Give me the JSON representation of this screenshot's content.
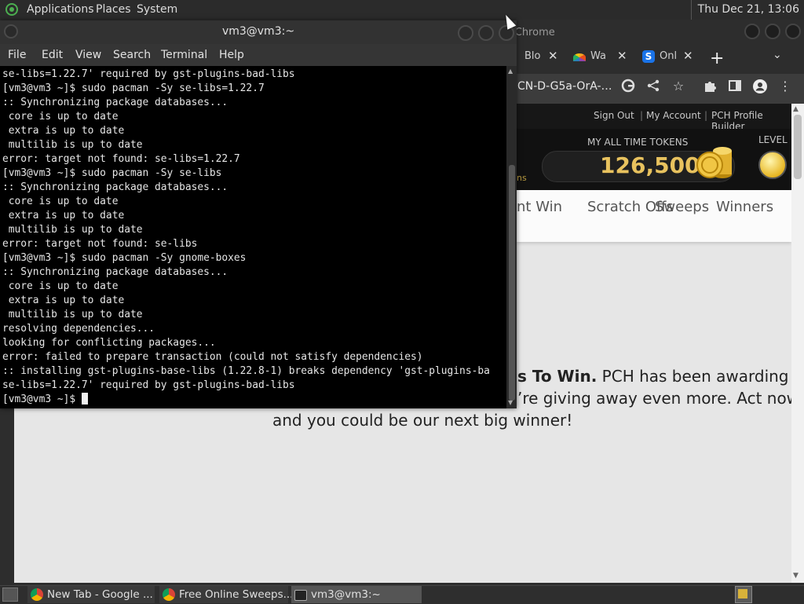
{
  "top_panel": {
    "menus": [
      "Applications",
      "Places",
      "System"
    ],
    "clock": "Thu Dec 21, 13:06"
  },
  "chrome": {
    "title_fragment": "le Chrome",
    "tabs": [
      {
        "label": "Blo",
        "icon": "tab-favicon"
      },
      {
        "label": "Wa",
        "icon": "nbc-peacock-icon"
      },
      {
        "label": "Onl",
        "icon": "s-logo-icon"
      }
    ],
    "url_fragment": "CN-D-G5a-OrA-…",
    "page": {
      "header_links": [
        "Sign Out",
        "My Account",
        "PCH Profile Builder"
      ],
      "tokens_label": "MY ALL TIME TOKENS",
      "tokens_value": "126,500",
      "level_label": "LEVEL",
      "tokens_fragment": "ns",
      "nav_items": [
        "nt Win",
        "Scratch Offs",
        "Sweeps",
        "Winners"
      ],
      "promo_bold": "s To Win.",
      "promo_line1_rest": " PCH has been awarding",
      "promo_line2": "’re giving away even more. Act now",
      "promo_line3": "and you could be our next big winner!"
    }
  },
  "terminal": {
    "title": "vm3@vm3:~",
    "menus": [
      "File",
      "Edit",
      "View",
      "Search",
      "Terminal",
      "Help"
    ],
    "lines": [
      "se-libs=1.22.7' required by gst-plugins-bad-libs",
      "[vm3@vm3 ~]$ sudo pacman -Sy se-libs=1.22.7",
      ":: Synchronizing package databases...",
      " core is up to date",
      " extra is up to date",
      " multilib is up to date",
      "error: target not found: se-libs=1.22.7",
      "[vm3@vm3 ~]$ sudo pacman -Sy se-libs",
      ":: Synchronizing package databases...",
      " core is up to date",
      " extra is up to date",
      " multilib is up to date",
      "error: target not found: se-libs",
      "[vm3@vm3 ~]$ sudo pacman -Sy gnome-boxes",
      ":: Synchronizing package databases...",
      " core is up to date",
      " extra is up to date",
      " multilib is up to date",
      "resolving dependencies...",
      "looking for conflicting packages...",
      "error: failed to prepare transaction (could not satisfy dependencies)",
      ":: installing gst-plugins-base-libs (1.22.8-1) breaks dependency 'gst-plugins-ba",
      "se-libs=1.22.7' required by gst-plugins-bad-libs"
    ],
    "prompt": "[vm3@vm3 ~]$ "
  },
  "taskbar": {
    "items": [
      {
        "label": "New Tab - Google ...",
        "icon": "chrome-icon"
      },
      {
        "label": "Free Online Sweeps...",
        "icon": "chrome-icon"
      },
      {
        "label": "vm3@vm3:~",
        "icon": "terminal-icon"
      }
    ]
  },
  "colors": {
    "token_gold": "#e8c25e",
    "terminal_bg": "#000000",
    "panel_bg": "#2b2b2b"
  }
}
